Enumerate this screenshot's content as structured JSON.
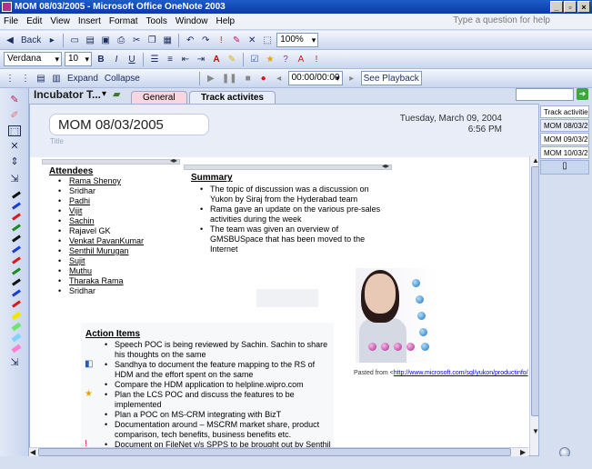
{
  "window": {
    "title": "MOM 08/03/2005 - Microsoft Office OneNote 2003",
    "controls": [
      "_",
      "▫",
      "×"
    ]
  },
  "menu": {
    "items": [
      "File",
      "Edit",
      "View",
      "Insert",
      "Format",
      "Tools",
      "Window",
      "Help"
    ],
    "help_placeholder": "Type a question for help"
  },
  "toolbar1": {
    "back_label": "Back",
    "zoom": "100%"
  },
  "toolbar2": {
    "font": "Verdana",
    "size": "10",
    "bold": "B",
    "italic": "I",
    "underline": "U"
  },
  "toolbar3": {
    "expand_label": "Expand",
    "collapse_label": "Collapse",
    "time": "00:00/00:00",
    "playback_label": "See Playback"
  },
  "notebook": {
    "title": "Incubator T...",
    "tabs": [
      "General",
      "Track activites"
    ]
  },
  "page": {
    "title": "MOM 08/03/2005",
    "title_hint": "Title",
    "date": "Tuesday, March 09, 2004",
    "time": "6:56 PM"
  },
  "attendees": {
    "heading": "Attendees",
    "names": [
      "Rama Shenoy",
      "Sridhar",
      "Padhi",
      "Vijit",
      "Sachin",
      "Rajavel GK",
      "Venkat PavanKumar",
      "Senthil Murugan",
      "Sujit",
      "Muthu",
      "Tharaka Rama",
      "Sridhar"
    ]
  },
  "summary": {
    "heading": "Summary",
    "items": [
      "The topic of discussion was a discussion on Yukon by Siraj from the Hyderabad team",
      "Rama gave an update on the various pre-sales activities during the week",
      "The team was given an overview of GMSBUSpace that has been moved to the Internet"
    ]
  },
  "action_items": {
    "heading": "Action Items",
    "items": [
      "Speech POC is being reviewed by Sachin. Sachin to share his thoughts on the same",
      "Sandhya to document the feature mapping to the RS of HDM and the effort spent on the same",
      "Compare the HDM application to helpline.wipro.com",
      "Plan the LCS POC and discuss the features to be implemented",
      "Plan a POC on MS-CRM integrating with BizT",
      "Documentation around – MSCRM market share, product comparison, tech benefits, business benefits etc.",
      "Document on FileNet v/s SPPS to be brought out by Senthil and Venkat."
    ]
  },
  "pasted": {
    "prefix": "Pasted from <",
    "link": "http://www.microsoft.com/sql/yukon/productinfo/"
  },
  "page_tabs": [
    "Track activitie",
    "MOM 08/03/2",
    "MOM 09/03/2",
    "MOM 10/03/2"
  ]
}
